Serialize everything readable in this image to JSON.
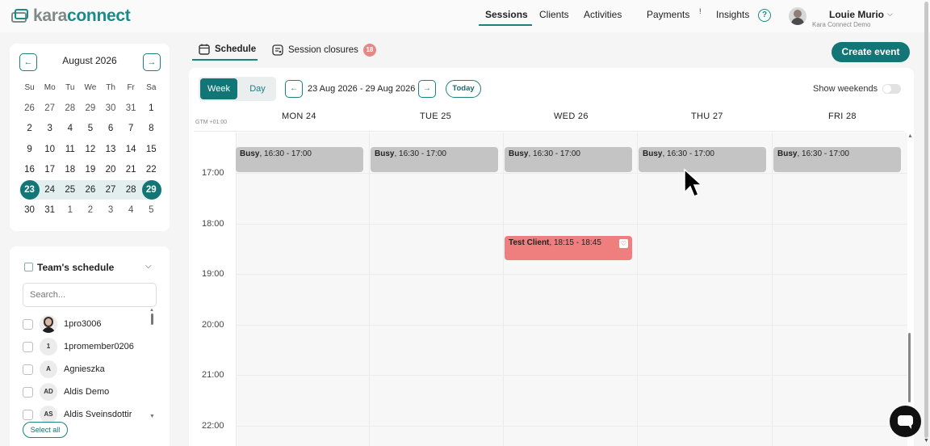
{
  "brand": {
    "logo_part1": "kara",
    "logo_part2": "connect",
    "logo_color": "#1a8a8a",
    "logo_gray": "#7f8a87"
  },
  "nav": {
    "items": [
      {
        "label": "Sessions",
        "active": true
      },
      {
        "label": "Clients"
      },
      {
        "label": "Activities"
      },
      {
        "label": "Payments",
        "badge": "!"
      },
      {
        "label": "Insights"
      }
    ],
    "help_icon": "?",
    "user": {
      "name": "Louie Murio",
      "subtitle": "Kara Connect Demo"
    }
  },
  "mini_calendar": {
    "month_label": "August 2026",
    "prev": "←",
    "next": "→",
    "weekdays": [
      "Su",
      "Mo",
      "Tu",
      "We",
      "Th",
      "Fr",
      "Sa"
    ],
    "weeks": [
      [
        "26",
        "27",
        "28",
        "29",
        "30",
        "31",
        "1"
      ],
      [
        "2",
        "3",
        "4",
        "5",
        "6",
        "7",
        "8"
      ],
      [
        "9",
        "10",
        "11",
        "12",
        "13",
        "14",
        "15"
      ],
      [
        "16",
        "17",
        "18",
        "19",
        "20",
        "21",
        "22"
      ],
      [
        "23",
        "24",
        "25",
        "26",
        "27",
        "28",
        "29"
      ],
      [
        "30",
        "31",
        "1",
        "2",
        "3",
        "4",
        "5"
      ]
    ]
  },
  "team": {
    "title": "Team's schedule",
    "search_placeholder": "Search...",
    "members": [
      {
        "initials": "",
        "name": "1pro3006",
        "photo": true
      },
      {
        "initials": "1",
        "name": "1promember0206"
      },
      {
        "initials": "A",
        "name": "Agnieszka"
      },
      {
        "initials": "AD",
        "name": "Aldis Demo"
      },
      {
        "initials": "AS",
        "name": "Aldis Sveinsdottir"
      }
    ],
    "select_all": "Select all"
  },
  "tabs": [
    {
      "label": "Schedule",
      "active": true
    },
    {
      "label": "Session closures",
      "badge": "18"
    }
  ],
  "create_event": "Create event",
  "toolbar": {
    "week": "Week",
    "day": "Day",
    "prev": "←",
    "next": "→",
    "range": "23 Aug 2026 - 29 Aug 2026",
    "today": "Today",
    "show_weekends": "Show weekends"
  },
  "timezone": "GTM +01:00",
  "days": [
    {
      "label": "MON  24"
    },
    {
      "label": "TUE  25"
    },
    {
      "label": "WED  26"
    },
    {
      "label": "THU  27"
    },
    {
      "label": "FRI  28"
    }
  ],
  "time_labels": [
    "17:00",
    "18:00",
    "19:00",
    "20:00",
    "21:00",
    "22:00"
  ],
  "events": {
    "busy": [
      {
        "title": "Busy",
        "time": ", 16:30 - 17:00"
      },
      {
        "title": "Busy",
        "time": ", 16:30 - 17:00"
      },
      {
        "title": "Busy",
        "time": ", 16:30 - 17:00"
      },
      {
        "title": "Busy",
        "time": ", 16:30 - 17:00"
      },
      {
        "title": "Busy",
        "time": ", 16:30 - 17:00"
      }
    ],
    "client": {
      "title": "Test Client",
      "time": ", 18:15 - 18:45"
    }
  },
  "colors": {
    "accent": "#137676",
    "busy": "#c4c4c4",
    "client": "#ef7f7f",
    "badge": "#e48a86"
  }
}
